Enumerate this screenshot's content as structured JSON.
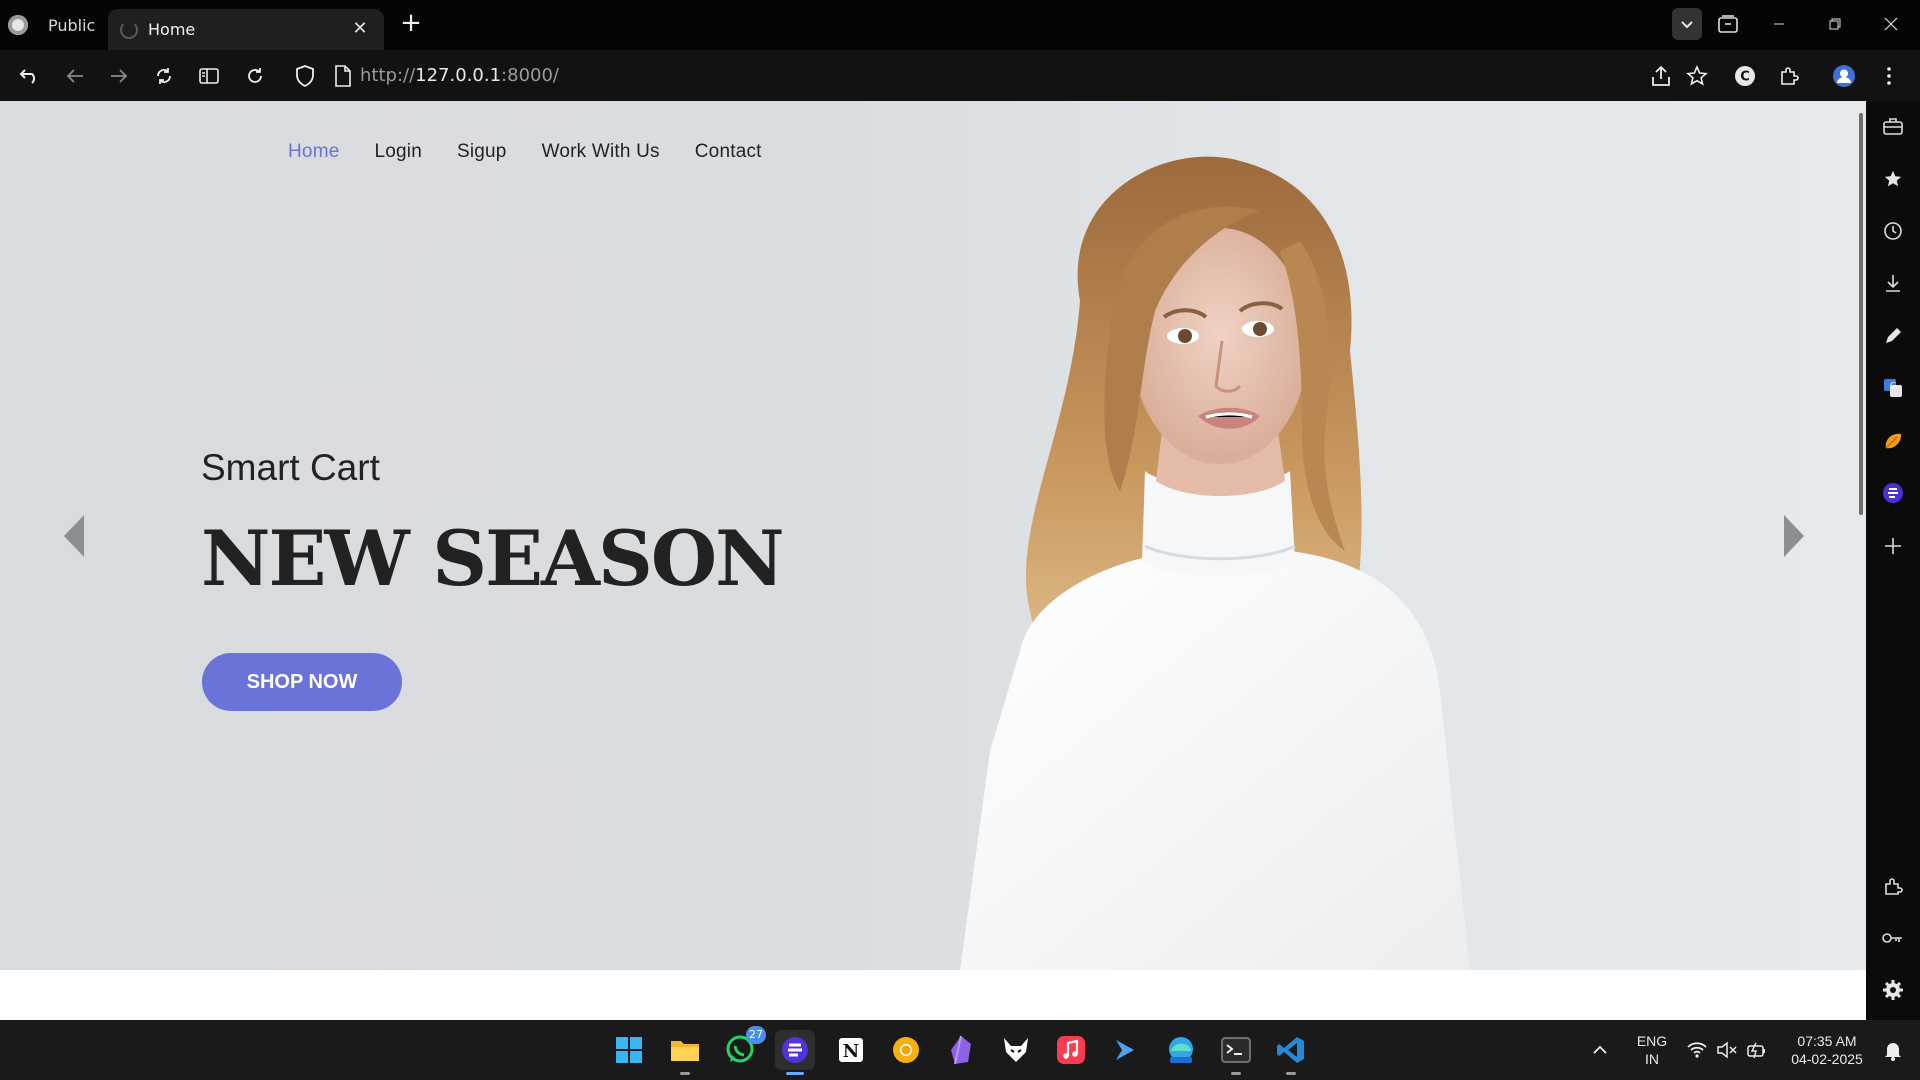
{
  "browser": {
    "profile_label": "Public",
    "tab_title": "Home",
    "tab_close": "✕",
    "new_tab": "+",
    "url_prefix": "http://",
    "url_host": "127.0.0.1",
    "url_rest": ":8000/"
  },
  "site": {
    "nav": [
      "Home",
      "Login",
      "Sigup",
      "Work With Us",
      "Contact"
    ],
    "active_nav": "Home",
    "tagline": "Smart Cart",
    "headline": "NEW SEASON",
    "cta": "SHOP NOW"
  },
  "sidebar_icons": [
    "briefcase-icon",
    "star-icon",
    "history-icon",
    "download-icon",
    "pen-icon",
    "translate-icon",
    "orange-app-icon",
    "edge-copilot-icon",
    "add-icon",
    "extensions-icon",
    "key-icon",
    "gear-icon"
  ],
  "taskbar": {
    "apps": [
      "windows-start",
      "file-explorer",
      "whatsapp",
      "edge",
      "notion",
      "chrome-canary",
      "obsidian",
      "fox-app",
      "music",
      "powershell-dev",
      "edge-preview",
      "terminal",
      "vscode"
    ],
    "whatsapp_badge": "27",
    "lang_line1": "ENG",
    "lang_line2": "IN",
    "time": "07:35 AM",
    "date": "04-02-2025"
  },
  "colors": {
    "accent": "#6a73d8",
    "hero_bg": "#dadde0",
    "headline": "#222222"
  }
}
